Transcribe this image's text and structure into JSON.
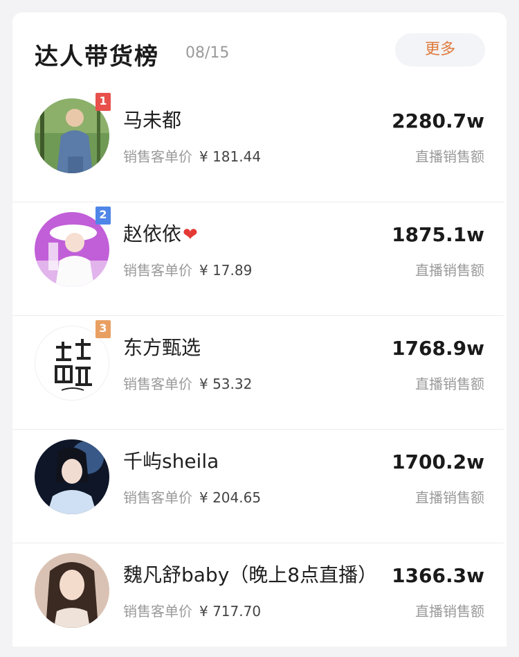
{
  "header": {
    "title": "达人带货榜",
    "date": "08/15",
    "more_label": "更多"
  },
  "price_label": "销售客单价",
  "sales_label": "直播销售额",
  "rank_colors": {
    "1": "#e8504b",
    "2": "#4f86e8",
    "3": "#e8a062"
  },
  "influencers": [
    {
      "rank": "1",
      "name": "马未都",
      "price": "¥ 181.44",
      "sales": "2280.7w"
    },
    {
      "rank": "2",
      "name": "赵依依",
      "suffix": "❤",
      "price": "¥ 17.89",
      "sales": "1875.1w"
    },
    {
      "rank": "3",
      "name": "东方甄选",
      "price": "¥ 53.32",
      "sales": "1768.9w"
    },
    {
      "rank": "",
      "name": "千屿sheila",
      "price": "¥ 204.65",
      "sales": "1700.2w"
    },
    {
      "rank": "",
      "name": "魏凡舒baby（晚上8点直播）",
      "price": "¥ 717.70",
      "sales": "1366.3w"
    }
  ]
}
